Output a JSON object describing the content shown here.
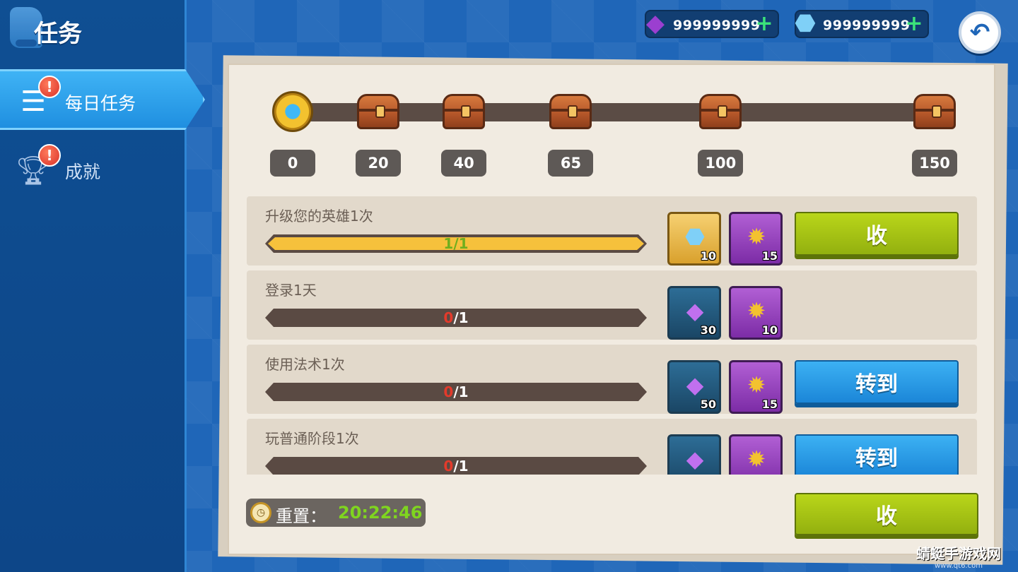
{
  "page": {
    "title": "任务"
  },
  "sidebar": {
    "items": [
      {
        "label": "每日任务",
        "icon": "task-list-icon",
        "active": true,
        "alert": "!"
      },
      {
        "label": "成就",
        "icon": "trophy-icon",
        "active": false,
        "alert": "!"
      }
    ]
  },
  "currency": {
    "purple_gem": {
      "icon": "purple-gem-icon",
      "value": "999999999",
      "plus": "+"
    },
    "blue_gem": {
      "icon": "blue-crystal-icon",
      "value": "999999999",
      "plus": "+"
    }
  },
  "milestones": [
    {
      "points": "0",
      "icon": "medal-icon",
      "pos": 0
    },
    {
      "points": "20",
      "icon": "chest-icon",
      "pos": 20
    },
    {
      "points": "40",
      "icon": "chest-icon",
      "pos": 40
    },
    {
      "points": "65",
      "icon": "chest-icon",
      "pos": 65
    },
    {
      "points": "100",
      "icon": "chest-icon",
      "pos": 100
    },
    {
      "points": "150",
      "icon": "chest-icon",
      "pos": 150
    }
  ],
  "tasks": [
    {
      "title": "升级您的英雄1次",
      "progress_current": "1",
      "progress_total": "/1",
      "progress_fraction": 1.0,
      "completed": true,
      "rewards": [
        {
          "icon": "blue-crystal-icon",
          "count": "10",
          "style": "gold"
        },
        {
          "icon": "medal-icon",
          "count": "15",
          "style": "purple"
        }
      ],
      "button": {
        "label": "收",
        "style": "green"
      }
    },
    {
      "title": "登录1天",
      "progress_current": "0",
      "progress_total": "/1",
      "progress_fraction": 0.0,
      "completed": false,
      "rewards": [
        {
          "icon": "purple-gem-icon",
          "count": "30",
          "style": "teal"
        },
        {
          "icon": "medal-icon",
          "count": "10",
          "style": "purple"
        }
      ],
      "button": null
    },
    {
      "title": "使用法术1次",
      "progress_current": "0",
      "progress_total": "/1",
      "progress_fraction": 0.0,
      "completed": false,
      "rewards": [
        {
          "icon": "purple-gem-icon",
          "count": "50",
          "style": "teal"
        },
        {
          "icon": "medal-icon",
          "count": "15",
          "style": "purple"
        }
      ],
      "button": {
        "label": "转到",
        "style": "blue"
      }
    },
    {
      "title": "玩普通阶段1次",
      "progress_current": "0",
      "progress_total": "/1",
      "progress_fraction": 0.0,
      "completed": false,
      "rewards": [
        {
          "icon": "purple-gem-icon",
          "count": "",
          "style": "teal"
        },
        {
          "icon": "medal-icon",
          "count": "",
          "style": "purple"
        }
      ],
      "button": {
        "label": "转到",
        "style": "blue"
      }
    }
  ],
  "footer": {
    "reset_label": "重置：",
    "reset_time": "20:22:46",
    "collect_all_label": "收"
  },
  "watermark": {
    "text": "蜻蜓手游戏网",
    "url": "www.qt6.com"
  },
  "colors": {
    "background": "#1f66b8",
    "accent_green": "#93b00f",
    "accent_blue": "#1b86d8",
    "progress_yellow": "#f6c13c",
    "progress_red": "#e33a2b",
    "timer_green": "#7fd51f"
  }
}
